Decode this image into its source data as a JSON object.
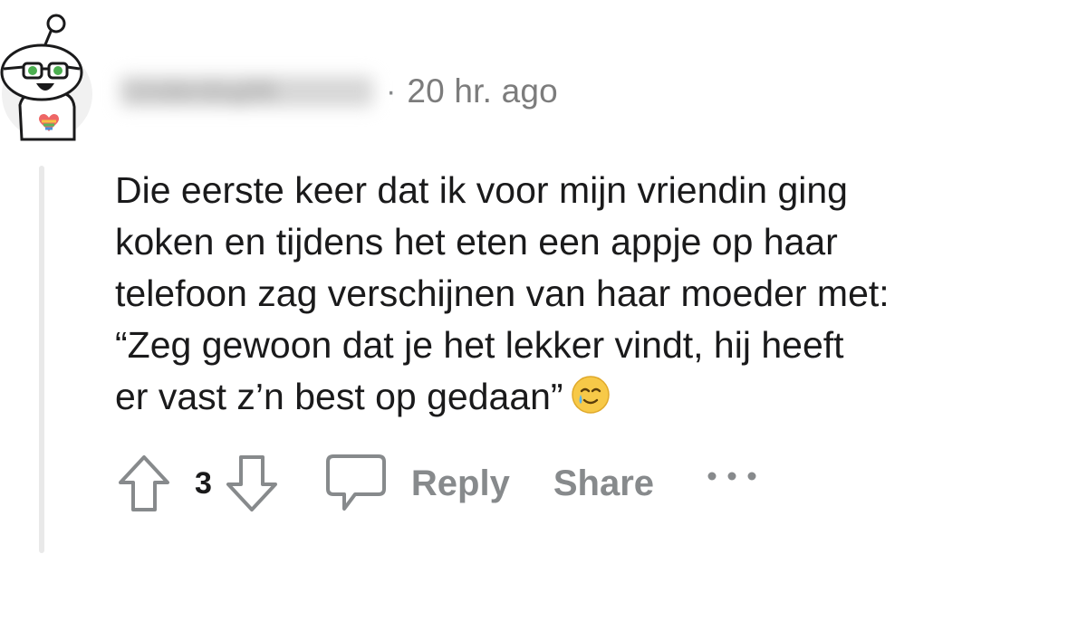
{
  "comment": {
    "username": "Underdog96",
    "separator": "·",
    "timestamp": "20 hr. ago",
    "body_lines": [
      "Die eerste keer dat ik voor mijn vriendin ging",
      "koken en tijdens het eten een appje op haar",
      "telefoon zag verschijnen van haar moeder met:",
      "“Zeg gewoon dat je het lekker vindt, hij heeft",
      "er vast z’n best op gedaan”"
    ],
    "emoji": "smiling-face-with-tear",
    "avatar": "snoo-avatar-glasses-rainbow-heart"
  },
  "actions": {
    "score": "3",
    "upvote_icon": "upvote-arrow-icon",
    "downvote_icon": "downvote-arrow-icon",
    "reply_icon": "speech-bubble-icon",
    "reply_label": "Reply",
    "share_label": "Share",
    "more_icon": "ellipsis-icon"
  },
  "colors": {
    "text": "#1a1a1b",
    "meta": "#7c7c7c",
    "action": "#878a8c",
    "thread_line": "#e9e9e9"
  }
}
